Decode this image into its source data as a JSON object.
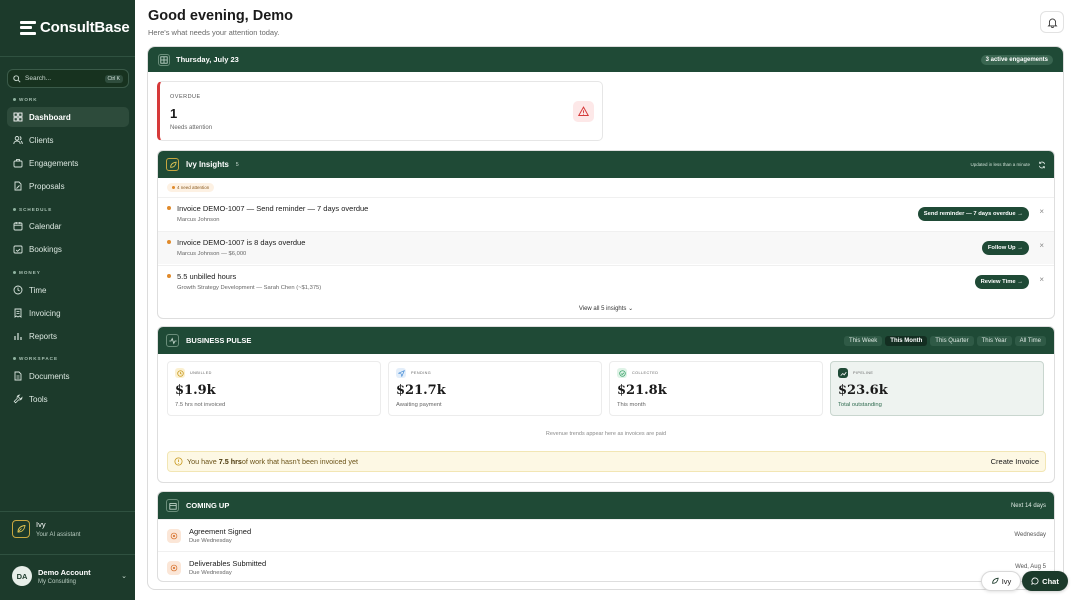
{
  "app": {
    "name": "ConsultBase"
  },
  "search": {
    "placeholder": "Search...",
    "shortcut": "Ctrl K"
  },
  "sidebar": {
    "sections": [
      {
        "label": "WORK",
        "items": [
          "Dashboard",
          "Clients",
          "Engagements",
          "Proposals"
        ]
      },
      {
        "label": "SCHEDULE",
        "items": [
          "Calendar",
          "Bookings"
        ]
      },
      {
        "label": "MONEY",
        "items": [
          "Time",
          "Invoicing",
          "Reports"
        ]
      },
      {
        "label": "WORKSPACE",
        "items": [
          "Documents",
          "Tools"
        ]
      }
    ],
    "active": "Dashboard"
  },
  "assistant": {
    "name": "Ivy",
    "subtitle": "Your AI assistant"
  },
  "account": {
    "initials": "DA",
    "name": "Demo Account",
    "org": "My Consulting"
  },
  "header": {
    "greeting": "Good evening, Demo",
    "subtitle": "Here's what needs your attention today."
  },
  "today": {
    "date": "Thursday, July 23",
    "engagements_badge": "3 active engagements"
  },
  "overdue": {
    "label": "OVERDUE",
    "count": "1",
    "sub": "Needs attention"
  },
  "insights": {
    "title": "Ivy Insights",
    "count": "5",
    "updated": "Updated in less than a minute",
    "attention_badge": "4 need attention",
    "items": [
      {
        "title": "Invoice DEMO-1007 — Send reminder — 7 days overdue",
        "sub": "Marcus Johnson",
        "action": "Send reminder — 7 days overdue"
      },
      {
        "title": "Invoice DEMO-1007 is 8 days overdue",
        "sub": "Marcus Johnson — $6,000",
        "action": "Follow Up"
      },
      {
        "title": "5.5 unbilled hours",
        "sub": "Growth Strategy Development — Sarah Chen (~$1,375)",
        "action": "Review Time"
      }
    ],
    "view_all": "View all 5 insights"
  },
  "pulse": {
    "title": "BUSINESS PULSE",
    "periods": [
      "This Week",
      "This Month",
      "This Quarter",
      "This Year",
      "All Time"
    ],
    "active_period": "This Month",
    "stats": [
      {
        "label": "UNBILLED",
        "value": "$1.9k",
        "sub": "7.5 hrs not invoiced",
        "color": "#e0b030"
      },
      {
        "label": "PENDING",
        "value": "$21.7k",
        "sub": "Awaiting payment",
        "color": "#4a8fd6"
      },
      {
        "label": "COLLECTED",
        "value": "$21.8k",
        "sub": "This month",
        "color": "#3aa26a"
      },
      {
        "label": "PIPELINE",
        "value": "$23.6k",
        "sub": "Total outstanding",
        "color": "#1f4a36"
      }
    ],
    "trend_note": "Revenue trends appear here as invoices are paid",
    "unbilled_prefix": "You have ",
    "unbilled_hours": "7.5 hrs",
    "unbilled_suffix": "of work that hasn't been invoiced yet",
    "create_invoice": "Create Invoice"
  },
  "coming": {
    "title": "COMING UP",
    "range": "Next 14 days",
    "items": [
      {
        "title": "Agreement Signed",
        "sub": "Due Wednesday",
        "when": "Wednesday"
      },
      {
        "title": "Deliverables Submitted",
        "sub": "Due Wednesday",
        "when": "Wed, Aug 5"
      }
    ]
  },
  "fabs": {
    "ivy": "Ivy",
    "chat": "Chat"
  }
}
